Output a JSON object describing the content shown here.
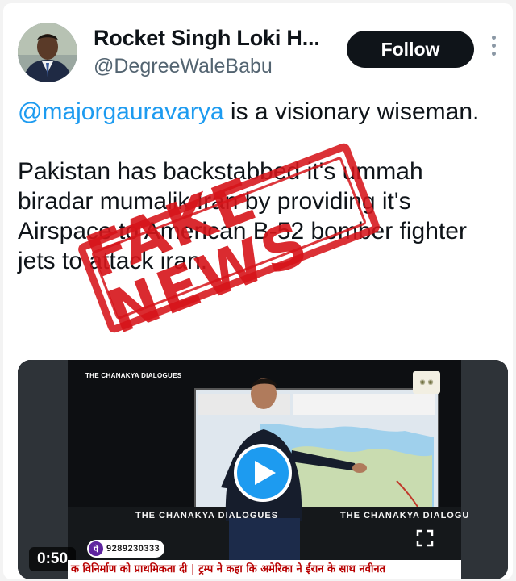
{
  "tweet": {
    "author": {
      "display_name": "Rocket Singh Loki H...",
      "handle": "@DegreeWaleBabu"
    },
    "follow_label": "Follow",
    "mention": "@majorgauravarya",
    "line1_rest": " is a visionary wiseman.",
    "paragraph2": "Pakistan has backstabbed it's ummah biradar mumalik Iran by providing it's Airspace to American B-52 bomber fighter jets to attack iran."
  },
  "overlay": {
    "stamp_text": "FAKE NEWS"
  },
  "video": {
    "duration": "0:50",
    "show_logo": "THE CHANAKYA DIALOGUES",
    "desk_label_left": "THE CHANAKYA DIALOGUES",
    "desk_label_right": "THE CHANAKYA DIALOGU",
    "support_number": "9289230333",
    "payment_glyph": "पे",
    "ticker": "क विनिर्माण को प्राथमिकता दी | ट्रम्प ने कहा कि अमेरिका ने ईरान के साथ नवीनत"
  },
  "icons": {
    "more": "more-vertical-icon",
    "play": "play-icon",
    "fullscreen": "fullscreen-icon"
  },
  "colors": {
    "mention": "#1d9bf0",
    "follow_bg": "#0f1419",
    "play_button": "#1d9bf0",
    "stamp": "#d6141a",
    "ticker_text": "#b80000"
  }
}
